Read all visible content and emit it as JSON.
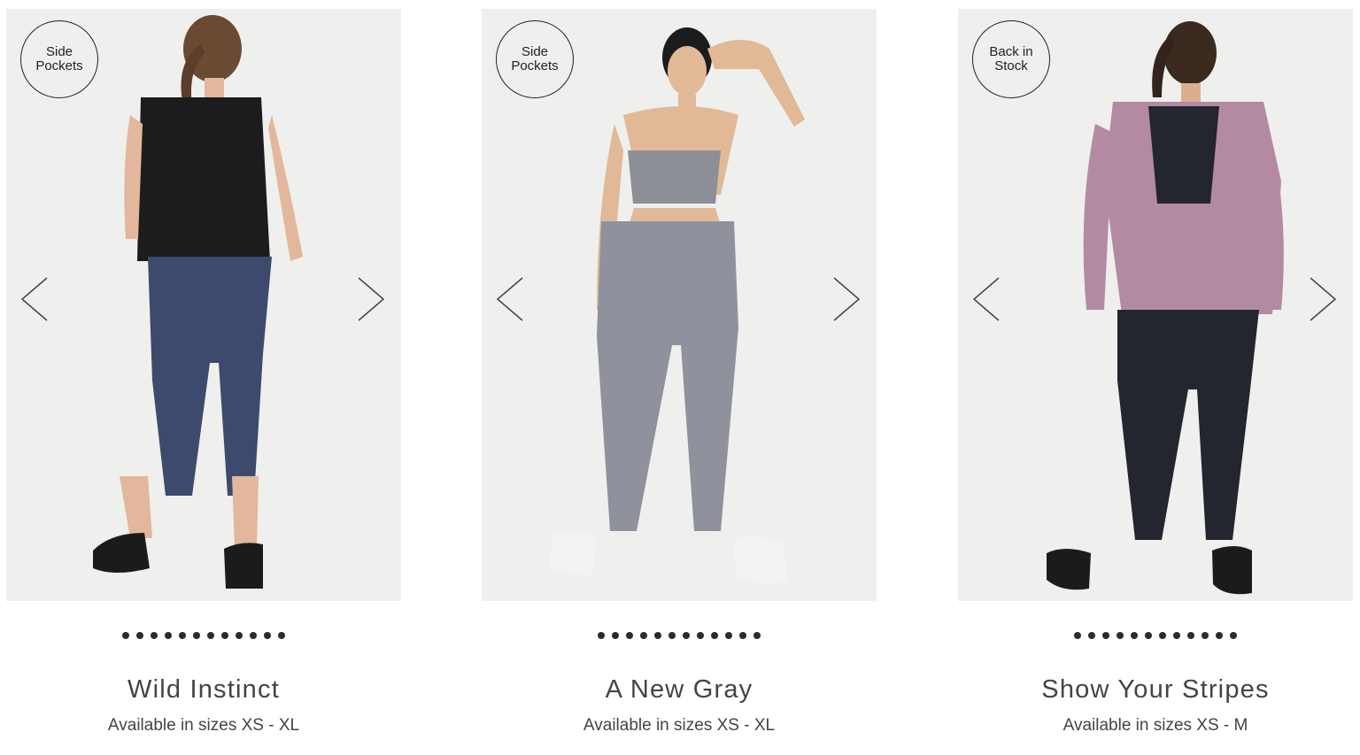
{
  "products": [
    {
      "badge": "Side Pockets",
      "title": "Wild Instinct",
      "sizes": "Available in sizes XS - XL",
      "dot_count": 12,
      "top_color": "#1c1c1e",
      "bottom_color": "#3d4a6e"
    },
    {
      "badge": "Side Pockets",
      "title": "A New Gray",
      "sizes": "Available in sizes XS - XL",
      "dot_count": 12,
      "top_color": "#8d8f98",
      "bottom_color": "#8f929c"
    },
    {
      "badge": "Back in Stock",
      "title": "Show Your Stripes",
      "sizes": "Available in sizes XS - M",
      "dot_count": 12,
      "top_color": "#b48aa2",
      "bottom_color": "#23252f"
    }
  ],
  "icons": {
    "prev": "chevron-left-icon",
    "next": "chevron-right-icon"
  }
}
